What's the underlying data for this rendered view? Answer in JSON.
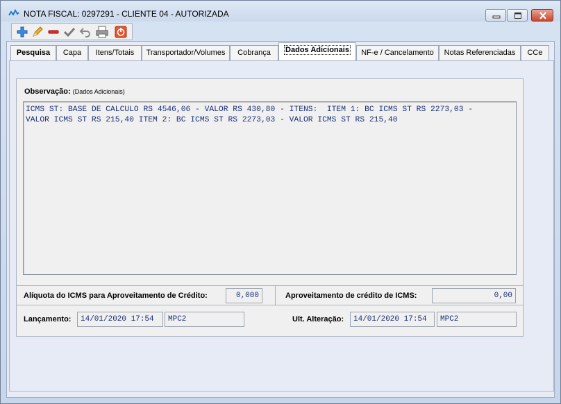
{
  "window": {
    "title": "NOTA FISCAL: 0297291 - CLIENTE 04 - AUTORIZADA",
    "accent": "#1e7ad6",
    "close_color": "#c8462f"
  },
  "toolbar": {
    "buttons": [
      {
        "icon": "add-icon",
        "color": "#2a7de1"
      },
      {
        "icon": "edit-pencil-icon",
        "color": "#e0a020"
      },
      {
        "icon": "remove-icon",
        "color": "#d32020"
      },
      {
        "icon": "confirm-check-icon",
        "color": "#808080"
      },
      {
        "icon": "undo-icon",
        "color": "#808080"
      },
      {
        "icon": "print-icon",
        "color": "#707070"
      },
      {
        "icon": "exit-icon",
        "color": "#e04020"
      }
    ]
  },
  "tabs": [
    {
      "label": "Pesquisa"
    },
    {
      "label": "Capa"
    },
    {
      "label": "Itens/Totais"
    },
    {
      "label": "Transportador/Volumes"
    },
    {
      "label": "Cobrança"
    },
    {
      "label": "Dados Adicionais"
    },
    {
      "label": "NF-e / Cancelamento"
    },
    {
      "label": "Notas Referenciadas"
    },
    {
      "label": "CCe"
    }
  ],
  "active_tab": "Dados Adicionais",
  "observacao": {
    "label": "Observação:",
    "sublabel": "(Dados Adicionais)",
    "line1": "ICMS ST: BASE DE CALCULO RS 4546,06 - VALOR RS 430,80 - ITENS:  ITEM 1: BC ICMS ST RS 2273,03 -",
    "line2": "VALOR ICMS ST RS 215,40 ITEM 2: BC ICMS ST RS 2273,03 - VALOR ICMS ST RS 215,40"
  },
  "credito": {
    "aliquota_label": "Alíquota do ICMS para Aproveitamento de Crédito:",
    "aliquota_value": "0,000",
    "aproveitamento_label": "Aproveitamento de crédito de ICMS:",
    "aproveitamento_value": "0,00"
  },
  "auditoria": {
    "lancamento_label": "Lançamento:",
    "lancamento_data": "14/01/2020 17:54",
    "lancamento_usuario": "MPC2",
    "alteracao_label": "Ult. Alteração:",
    "alteracao_data": "14/01/2020 17:54",
    "alteracao_usuario": "MPC2"
  }
}
